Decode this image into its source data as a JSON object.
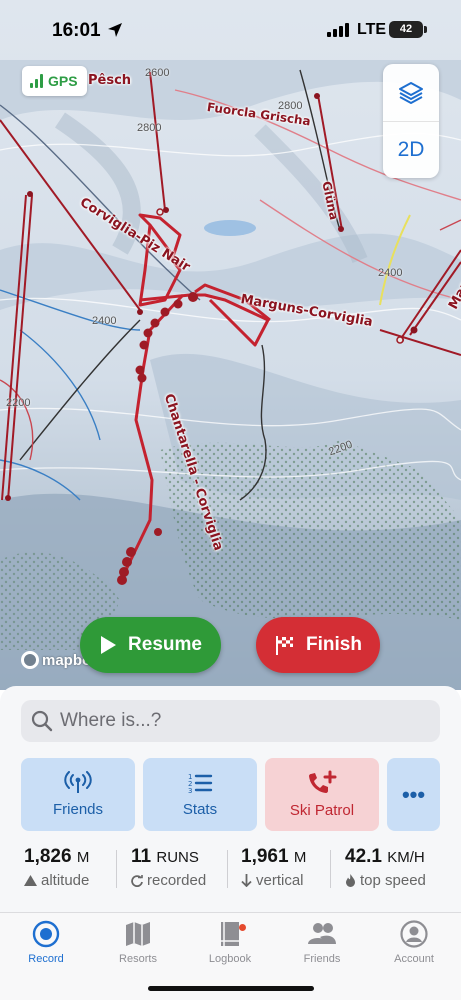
{
  "status_bar": {
    "time": "16:01",
    "network": "LTE",
    "battery": "42"
  },
  "gps": {
    "label": "GPS"
  },
  "map_controls": {
    "layers_icon": "layers-icon",
    "view_mode": "2D"
  },
  "map": {
    "run_labels": [
      "Pêsch",
      "Fuorcla Grischa",
      "Glüna",
      "Corviglia-Piz Nair",
      "Marguns-Corviglia",
      "Chantarella - Corviglia",
      "Marg"
    ],
    "contour_labels": [
      "2600",
      "2800",
      "2800",
      "2400",
      "2400",
      "2200",
      "2200"
    ],
    "attribution": "mapbox"
  },
  "buttons": {
    "resume": "Resume",
    "finish": "Finish"
  },
  "search": {
    "placeholder": "Where is...?"
  },
  "actions": [
    {
      "label": "Friends",
      "icon": "antenna-icon"
    },
    {
      "label": "Stats",
      "icon": "numbered-list-icon"
    },
    {
      "label": "Ski Patrol",
      "icon": "phone-plus-icon"
    },
    {
      "label": "•••",
      "icon": "more-icon"
    }
  ],
  "stats": [
    {
      "value": "1,826",
      "unit": "M",
      "label": "altitude",
      "icon": "mountain-icon"
    },
    {
      "value": "11",
      "unit": "RUNS",
      "label": "recorded",
      "icon": "repeat-icon"
    },
    {
      "value": "1,961",
      "unit": "M",
      "label": "vertical",
      "icon": "arrow-down-icon"
    },
    {
      "value": "42.1",
      "unit": "KM/H",
      "label": "top speed",
      "icon": "flame-icon"
    }
  ],
  "tabs": [
    {
      "label": "Record",
      "icon": "record-icon",
      "active": true
    },
    {
      "label": "Resorts",
      "icon": "map-icon"
    },
    {
      "label": "Logbook",
      "icon": "book-icon"
    },
    {
      "label": "Friends",
      "icon": "people-icon"
    },
    {
      "label": "Account",
      "icon": "account-icon"
    }
  ],
  "colors": {
    "accent": "#1e6fd0",
    "resume": "#2f9a38",
    "finish": "#d42e35",
    "track": "#c4222f",
    "run_line": "#b3202c"
  }
}
